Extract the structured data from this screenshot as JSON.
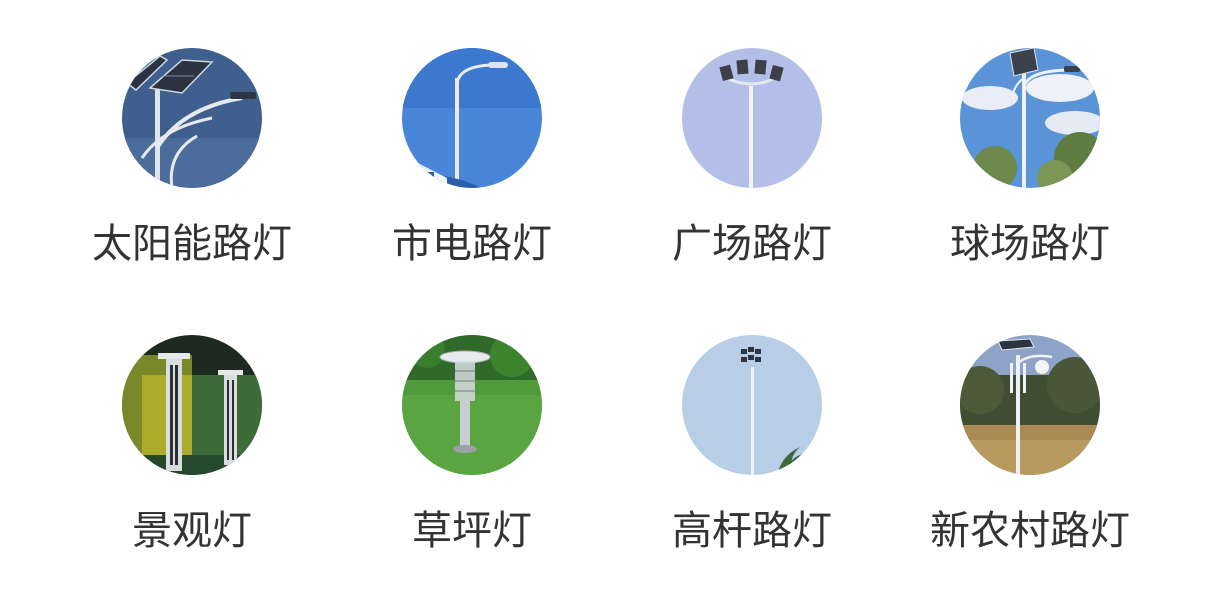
{
  "products": [
    {
      "label": "太阳能路灯",
      "icon": "solar-street-light-icon"
    },
    {
      "label": "市电路灯",
      "icon": "mains-street-light-icon"
    },
    {
      "label": "广场路灯",
      "icon": "plaza-light-icon"
    },
    {
      "label": "球场路灯",
      "icon": "stadium-light-icon"
    },
    {
      "label": "景观灯",
      "icon": "landscape-light-icon"
    },
    {
      "label": "草坪灯",
      "icon": "lawn-light-icon"
    },
    {
      "label": "高杆路灯",
      "icon": "high-mast-light-icon"
    },
    {
      "label": "新农村路灯",
      "icon": "rural-street-light-icon"
    }
  ],
  "colors": {
    "label_text": "#333333",
    "sky_blue": "#4f86d2",
    "pale_blue": "#b7c3e8"
  }
}
